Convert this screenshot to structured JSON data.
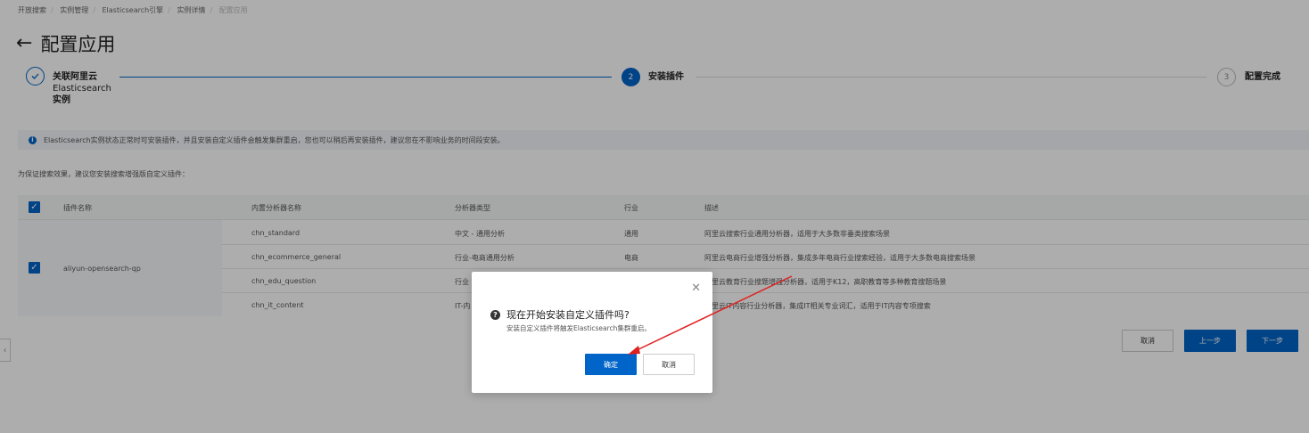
{
  "breadcrumb": [
    "开放搜索",
    "实例管理",
    "Elasticsearch引擎",
    "实例详情",
    "配置应用"
  ],
  "page_title": "配置应用",
  "steps": [
    {
      "label_line1": "关联阿里云",
      "label_line2": "Elasticsearch",
      "label_line3": "实例",
      "status": "done",
      "icon": "check-icon"
    },
    {
      "number": "2",
      "label": "安装插件",
      "status": "active"
    },
    {
      "number": "3",
      "label": "配置完成",
      "status": "wait"
    }
  ],
  "info_bar": {
    "icon": "info-icon",
    "text": "Elasticsearch实例状态正常时可安装插件，并且安装自定义插件会触发集群重启，您也可以稍后再安装插件，建议您在不影响业务的时间段安装。"
  },
  "hint": "为保证搜索效果，建议您安装搜索增强版自定义插件：",
  "table": {
    "headers": {
      "plugin": "插件名称",
      "analyzer": "内置分析器名称",
      "type": "分析器类型",
      "industry": "行业",
      "desc": "描述"
    },
    "plugin_name": "aliyun-opensearch-qp",
    "rows": [
      {
        "analyzer": "chn_standard",
        "type": "中文 - 通用分析",
        "industry": "通用",
        "desc": "阿里云搜索行业通用分析器，适用于大多数非垂类搜索场景"
      },
      {
        "analyzer": "chn_ecommerce_general",
        "type": "行业-电商通用分析",
        "industry": "电商",
        "desc": "阿里云电商行业增强分析器，集成多年电商行业搜索经验，适用于大多数电商搜索场景"
      },
      {
        "analyzer": "chn_edu_question",
        "type": "行业",
        "industry": "",
        "desc": "阿里云教育行业搜题增强分析器，适用于K12，高职教育等多种教育搜题场景"
      },
      {
        "analyzer": "chn_it_content",
        "type": "IT-内",
        "industry": "",
        "desc": "阿里云IT内容行业分析器，集成IT相关专业词汇，适用于IT内容专项搜索"
      }
    ]
  },
  "footer_buttons": {
    "cancel": "取消",
    "prev": "上一步",
    "next": "下一步"
  },
  "dialog": {
    "title": "现在开始安装自定义插件吗?",
    "description": "安装自定义插件将触发Elasticsearch集群重启。",
    "confirm": "确定",
    "cancel": "取消",
    "close_icon": "close-icon",
    "question_icon": "question-icon"
  },
  "colors": {
    "primary": "#0064c8",
    "annotation_arrow": "#e02020"
  }
}
